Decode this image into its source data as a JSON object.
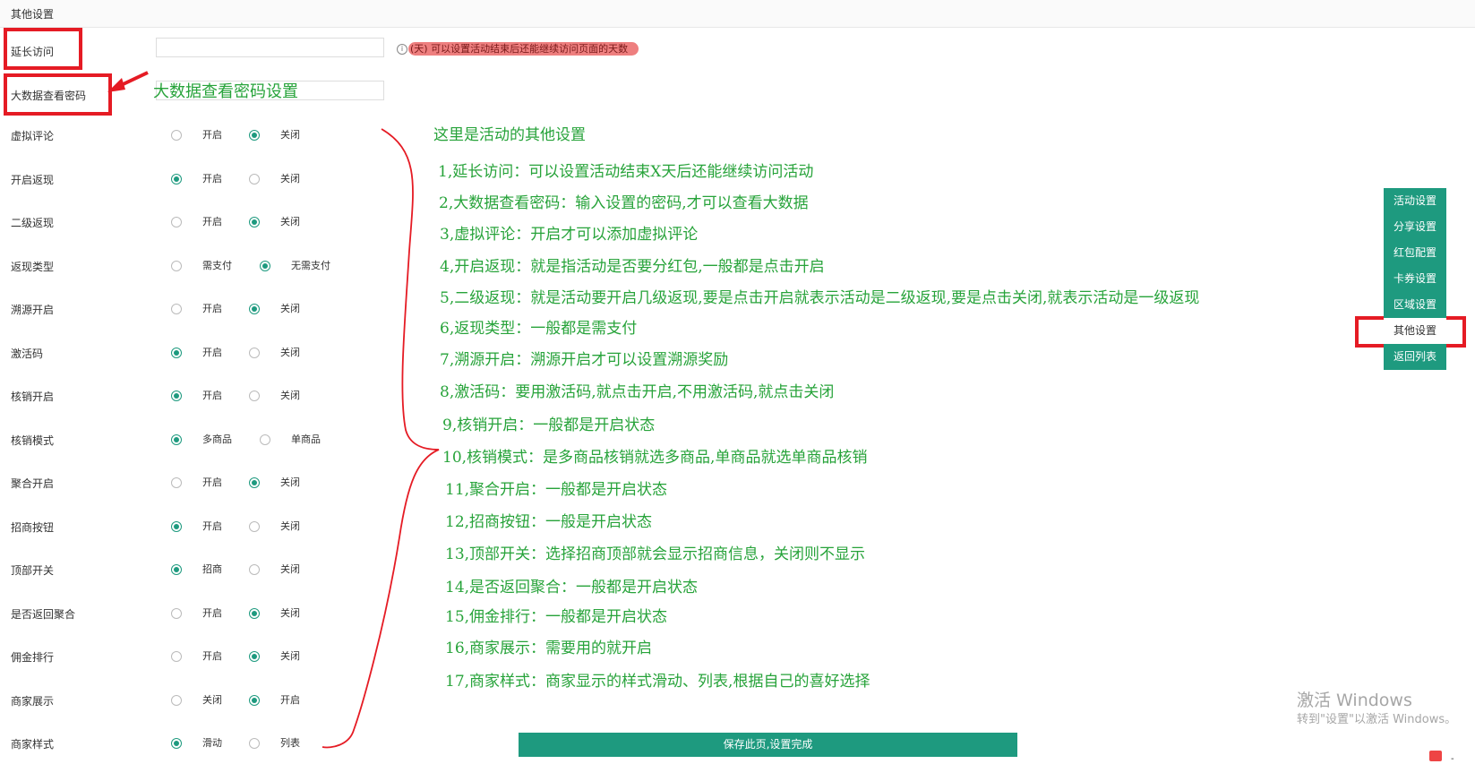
{
  "header": {
    "title": "其他设置"
  },
  "form": {
    "extend_visit": {
      "label": "延长访问",
      "value": "",
      "hint": "(天) 可以设置活动结束后还能继续访问页面的天数"
    },
    "bigdata_password": {
      "label": "大数据查看密码",
      "value": ""
    },
    "radio_rows": [
      {
        "label": "虚拟评论",
        "opt1": "开启",
        "opt2": "关闭",
        "selected": 2
      },
      {
        "label": "开启返现",
        "opt1": "开启",
        "opt2": "关闭",
        "selected": 1
      },
      {
        "label": "二级返现",
        "opt1": "开启",
        "opt2": "关闭",
        "selected": 2
      },
      {
        "label": "返现类型",
        "opt1": "需支付",
        "opt2": "无需支付",
        "selected": 2
      },
      {
        "label": "溯源开启",
        "opt1": "开启",
        "opt2": "关闭",
        "selected": 2
      },
      {
        "label": "激活码",
        "opt1": "开启",
        "opt2": "关闭",
        "selected": 1
      },
      {
        "label": "核销开启",
        "opt1": "开启",
        "opt2": "关闭",
        "selected": 1
      },
      {
        "label": "核销模式",
        "opt1": "多商品",
        "opt2": "单商品",
        "selected": 1
      },
      {
        "label": "聚合开启",
        "opt1": "开启",
        "opt2": "关闭",
        "selected": 2
      },
      {
        "label": "招商按钮",
        "opt1": "开启",
        "opt2": "关闭",
        "selected": 1
      },
      {
        "label": "顶部开关",
        "opt1": "招商",
        "opt2": "关闭",
        "selected": 1
      },
      {
        "label": "是否返回聚合",
        "opt1": "开启",
        "opt2": "关闭",
        "selected": 2
      },
      {
        "label": "佣金排行",
        "opt1": "开启",
        "opt2": "关闭",
        "selected": 2
      },
      {
        "label": "商家展示",
        "opt1": "关闭",
        "opt2": "开启",
        "selected": 2
      },
      {
        "label": "商家样式",
        "opt1": "滑动",
        "opt2": "列表",
        "selected": 1
      }
    ]
  },
  "annotations": {
    "bigdata_note": "大数据查看密码设置",
    "title": "这里是活动的其他设置",
    "notes": [
      "1,延长访问：可以设置活动结束X天后还能继续访问活动",
      "2,大数据查看密码：输入设置的密码,才可以查看大数据",
      "3,虚拟评论：开启才可以添加虚拟评论",
      "4,开启返现：就是指活动是否要分红包,一般都是点击开启",
      "5,二级返现：就是活动要开启几级返现,要是点击开启就表示活动是二级返现,要是点击关闭,就表示活动是一级返现",
      "6,返现类型：一般都是需支付",
      "7,溯源开启：溯源开启才可以设置溯源奖励",
      "8,激活码：要用激活码,就点击开启,不用激活码,就点击关闭",
      "9,核销开启：一般都是开启状态",
      "10,核销模式：是多商品核销就选多商品,单商品就选单商品核销",
      "11,聚合开启：一般都是开启状态",
      "12,招商按钮：一般是开启状态",
      "13,顶部开关：选择招商顶部就会显示招商信息，关闭则不显示",
      "14,是否返回聚合：一般都是开启状态",
      "15,佣金排行：一般都是开启状态",
      "16,商家展示：需要用的就开启",
      "17,商家样式：商家显示的样式滑动、列表,根据自己的喜好选择"
    ]
  },
  "side_menu": {
    "items": [
      "活动设置",
      "分享设置",
      "红包配置",
      "卡券设置",
      "区域设置",
      "其他设置",
      "返回列表"
    ],
    "active_index": 5
  },
  "save_button": "保存此页,设置完成",
  "watermark": {
    "line1": "激活 Windows",
    "line2": "转到\"设置\"以激活 Windows。"
  },
  "tray": {
    "text": "-"
  },
  "colors": {
    "accent": "#1e9a7f",
    "annotation_red": "#e51b24",
    "annotation_green": "#27a33a"
  }
}
